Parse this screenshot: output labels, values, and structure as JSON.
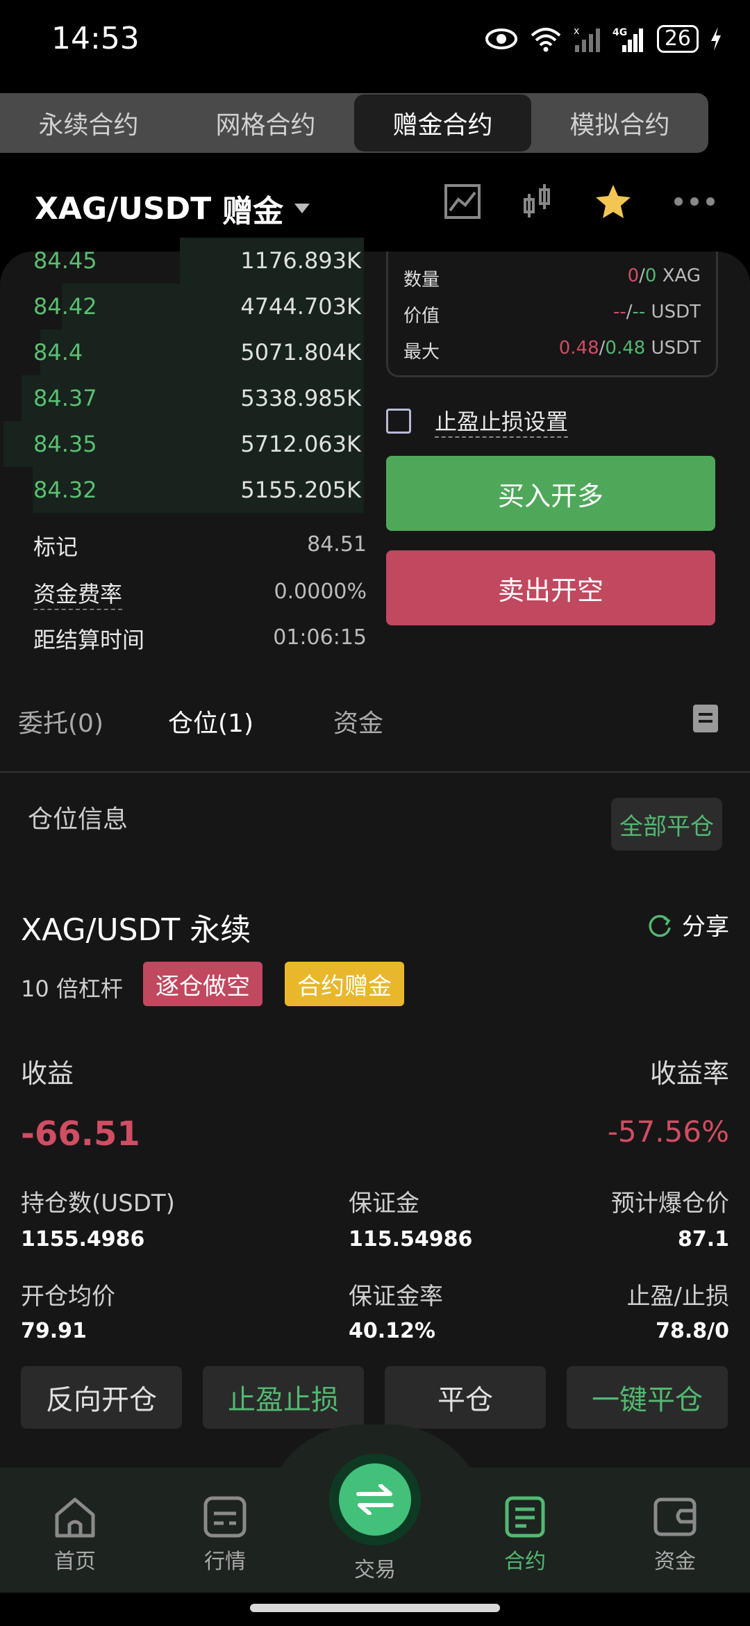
{
  "status": {
    "time": "14:53",
    "battery": "26"
  },
  "tabs": [
    {
      "label": "永续合约"
    },
    {
      "label": "网格合约"
    },
    {
      "label": "赠金合约"
    },
    {
      "label": "模拟合约"
    }
  ],
  "header": {
    "pair": "XAG/USDT",
    "mode": "赠金"
  },
  "orderbook": [
    {
      "price": "84.45",
      "qty": "1176.893K",
      "depth": 0.5
    },
    {
      "price": "84.42",
      "qty": "4744.703K",
      "depth": 0.82
    },
    {
      "price": "84.4",
      "qty": "5071.804K",
      "depth": 0.88
    },
    {
      "price": "84.37",
      "qty": "5338.985K",
      "depth": 0.93
    },
    {
      "price": "84.35",
      "qty": "5712.063K",
      "depth": 0.98
    },
    {
      "price": "84.32",
      "qty": "5155.205K",
      "depth": 0.9
    }
  ],
  "market_info": {
    "mark_label": "标记",
    "mark_value": "84.51",
    "funding_label": "资金费率",
    "funding_value": "0.0000%",
    "settle_label": "距结算时间",
    "settle_value": "01:06:15"
  },
  "order_box": {
    "qty_label": "数量",
    "qty_a": "0",
    "qty_sep": "/",
    "qty_b": "0",
    "qty_unit": " XAG",
    "val_label": "价值",
    "val_a": "--",
    "val_b": "--",
    "val_unit": " USDT",
    "max_label": "最大",
    "max_a": "0.48",
    "max_b": "0.48",
    "max_unit": " USDT"
  },
  "tpsl_label": "止盈止损设置",
  "buy_label": "买入开多",
  "sell_label": "卖出开空",
  "order_tabs": {
    "orders": "委托(0)",
    "positions": "仓位(1)",
    "assets": "资金"
  },
  "position": {
    "section_title": "仓位信息",
    "close_all": "全部平仓",
    "symbol": "XAG/USDT 永续",
    "share": "分享",
    "leverage": "10 倍杠杆",
    "badge_side": "逐仓做空",
    "badge_bonus": "合约赠金",
    "pnl_label": "收益",
    "pnl_value": "-66.51",
    "roe_label": "收益率",
    "roe_value": "-57.56%",
    "size_label": "持仓数(USDT)",
    "size_value": "1155.4986",
    "margin_label": "保证金",
    "margin_value": "115.54986",
    "liq_label": "预计爆仓价",
    "liq_value": "87.1",
    "entry_label": "开仓均价",
    "entry_value": "79.91",
    "mratio_label": "保证金率",
    "mratio_value": "40.12%",
    "tpsl_label": "止盈/止损",
    "tpsl_value": "78.8/0",
    "actions": [
      "反向开仓",
      "止盈止损",
      "平仓",
      "一键平仓"
    ]
  },
  "nav": [
    {
      "label": "首页"
    },
    {
      "label": "行情"
    },
    {
      "label": "交易"
    },
    {
      "label": "合约"
    },
    {
      "label": "资金"
    }
  ],
  "colors": {
    "green": "#53b872",
    "red": "#d14d63",
    "buy": "#4fa85a",
    "sell": "#c0485f",
    "bonus": "#e8b72b"
  }
}
